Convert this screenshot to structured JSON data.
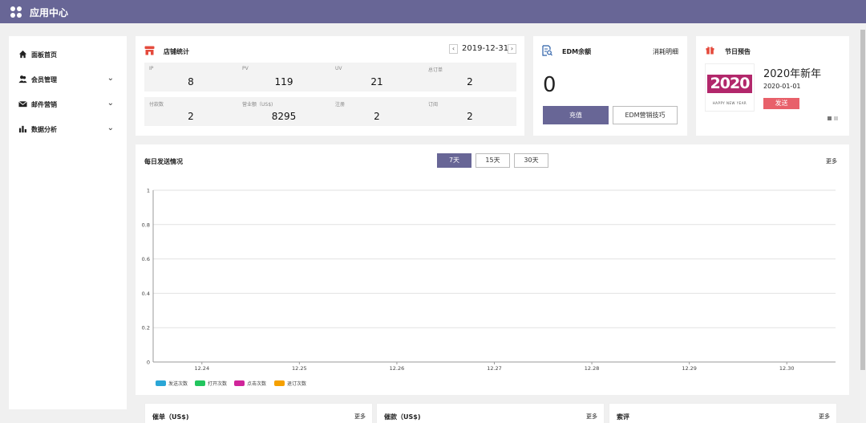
{
  "header": {
    "title": "应用中心"
  },
  "sidebar": {
    "items": [
      {
        "label": "面板首页",
        "icon": "home-icon",
        "expandable": false
      },
      {
        "label": "会员管理",
        "icon": "members-icon",
        "expandable": true
      },
      {
        "label": "邮件营销",
        "icon": "mail-icon",
        "expandable": true
      },
      {
        "label": "数据分析",
        "icon": "bar-chart-icon",
        "expandable": true
      }
    ]
  },
  "store_stats": {
    "title": "店铺统计",
    "date": "2019-12-31",
    "stats": [
      {
        "label": "IP",
        "value": "8"
      },
      {
        "label": "PV",
        "value": "119"
      },
      {
        "label": "UV",
        "value": "21"
      },
      {
        "label": "总订单",
        "value": "2"
      },
      {
        "label": "付款数",
        "value": "2"
      },
      {
        "label": "营业额（US$)",
        "value": "8295"
      },
      {
        "label": "注册",
        "value": "2"
      },
      {
        "label": "订阅",
        "value": "2"
      }
    ]
  },
  "edm": {
    "title": "EDM余额",
    "detail_link": "消耗明细",
    "balance": "0",
    "recharge_label": "充值",
    "tips_label": "EDM营销技巧"
  },
  "holiday": {
    "title": "节日预告",
    "event_name": "2020年新年",
    "event_date": "2020-01-01",
    "send_label": "发送",
    "image_text": "2020",
    "image_subtext": "HAPPY NEW YEAR"
  },
  "daily": {
    "title": "每日发送情况",
    "more_label": "更多",
    "tabs": [
      {
        "label": "7天",
        "active": true
      },
      {
        "label": "15天",
        "active": false
      },
      {
        "label": "30天",
        "active": false
      }
    ]
  },
  "chart_data": {
    "type": "line",
    "x": [
      "12.24",
      "12.25",
      "12.26",
      "12.27",
      "12.28",
      "12.29",
      "12.30"
    ],
    "y_ticks": [
      "0",
      "0.2",
      "0.4",
      "0.6",
      "0.8",
      "1"
    ],
    "ylim": [
      0,
      1
    ],
    "grid": true,
    "legend_position": "bottom-left",
    "series": [
      {
        "name": "发送次数",
        "color": "#2aa6d6",
        "values": []
      },
      {
        "name": "打开次数",
        "color": "#22c55e",
        "values": []
      },
      {
        "name": "点击次数",
        "color": "#d0259a",
        "values": []
      },
      {
        "name": "退订次数",
        "color": "#f5a000",
        "values": []
      }
    ]
  },
  "bottom_cards": [
    {
      "title": "催单（US$)",
      "more_label": "更多"
    },
    {
      "title": "催款（US$)",
      "more_label": "更多"
    },
    {
      "title": "索评",
      "more_label": "更多"
    }
  ]
}
